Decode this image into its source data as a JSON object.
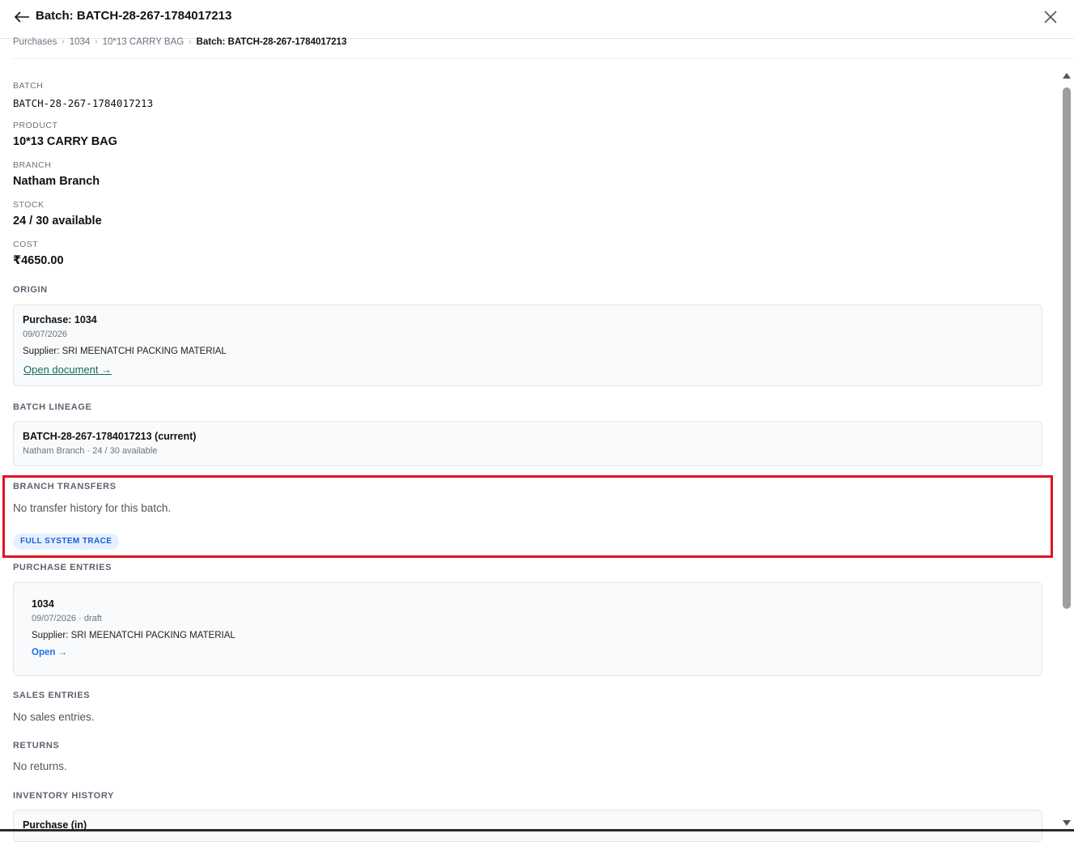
{
  "header": {
    "title": "Batch: BATCH-28-267-1784017213",
    "back_icon": "arrow-left-icon",
    "close_icon": "close-icon"
  },
  "breadcrumb": {
    "items": [
      "Purchases",
      "1034",
      "10*13 CARRY BAG"
    ],
    "current": "Batch: BATCH-28-267-1784017213",
    "separator": "›"
  },
  "details": {
    "batch_label": "BATCH",
    "batch_value": "BATCH-28-267-1784017213",
    "product_label": "PRODUCT",
    "product_value": "10*13 CARRY BAG",
    "branch_label": "BRANCH",
    "branch_value": "Natham Branch",
    "stock_label": "STOCK",
    "stock_value": "24 / 30 available",
    "cost_label": "COST",
    "cost_value": "₹4650.00"
  },
  "origin": {
    "section_title": "ORIGIN",
    "title": "Purchase: 1034",
    "date": "09/07/2026",
    "supplier": "Supplier: SRI MEENATCHI PACKING MATERIAL",
    "link": "Open document →"
  },
  "lineage": {
    "section_title": "BATCH LINEAGE",
    "title": "BATCH-28-267-1784017213 (current)",
    "meta": "Natham Branch · 24 / 30 available"
  },
  "transfers": {
    "section_title": "BRANCH TRANSFERS",
    "empty": "No transfer history for this batch.",
    "badge": "FULL SYSTEM TRACE"
  },
  "purchase_entries": {
    "section_title": "PURCHASE ENTRIES",
    "title": "1034",
    "meta": "09/07/2026 · draft",
    "supplier": "Supplier: SRI MEENATCHI PACKING MATERIAL",
    "link": "Open →"
  },
  "sales": {
    "section_title": "SALES ENTRIES",
    "empty": "No sales entries."
  },
  "returns": {
    "section_title": "RETURNS",
    "empty": "No returns."
  },
  "inventory": {
    "section_title": "INVENTORY HISTORY",
    "first_title": "Purchase (in)"
  },
  "colors": {
    "highlight": "#e0141e",
    "link_teal": "#0f6e5e",
    "link_blue": "#1a73e8",
    "badge_bg": "#e6f0fd"
  }
}
